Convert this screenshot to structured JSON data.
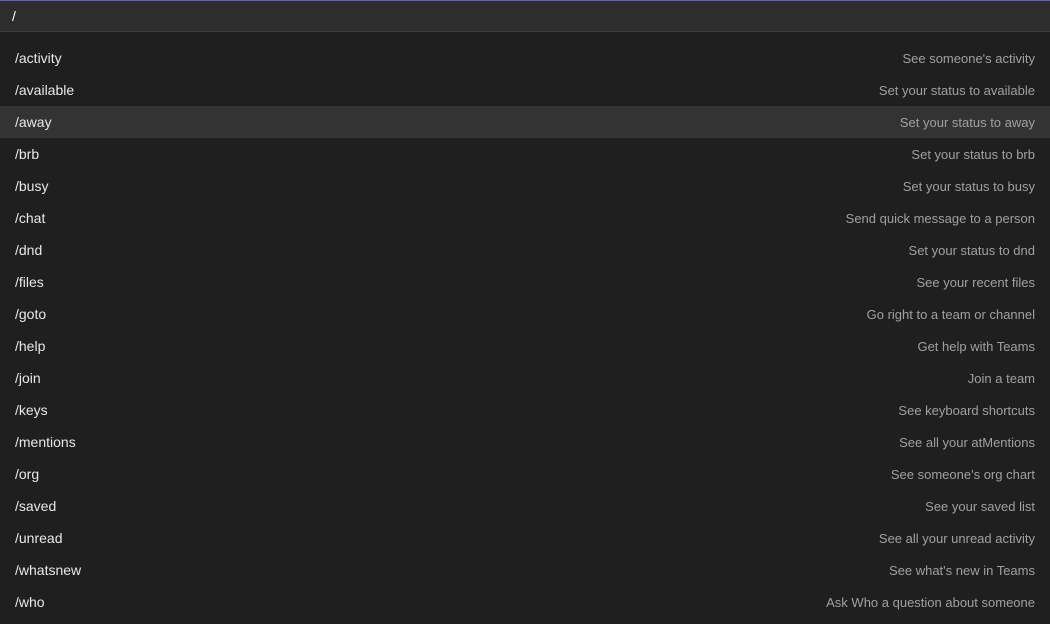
{
  "search": {
    "value": "/"
  },
  "commands": [
    {
      "name": "/activity",
      "desc": "See someone's activity",
      "highlighted": false
    },
    {
      "name": "/available",
      "desc": "Set your status to available",
      "highlighted": false
    },
    {
      "name": "/away",
      "desc": "Set your status to away",
      "highlighted": true
    },
    {
      "name": "/brb",
      "desc": "Set your status to brb",
      "highlighted": false
    },
    {
      "name": "/busy",
      "desc": "Set your status to busy",
      "highlighted": false
    },
    {
      "name": "/chat",
      "desc": "Send quick message to a person",
      "highlighted": false
    },
    {
      "name": "/dnd",
      "desc": "Set your status to dnd",
      "highlighted": false
    },
    {
      "name": "/files",
      "desc": "See your recent files",
      "highlighted": false
    },
    {
      "name": "/goto",
      "desc": "Go right to a team or channel",
      "highlighted": false
    },
    {
      "name": "/help",
      "desc": "Get help with Teams",
      "highlighted": false
    },
    {
      "name": "/join",
      "desc": "Join a team",
      "highlighted": false
    },
    {
      "name": "/keys",
      "desc": "See keyboard shortcuts",
      "highlighted": false
    },
    {
      "name": "/mentions",
      "desc": "See all your atMentions",
      "highlighted": false
    },
    {
      "name": "/org",
      "desc": "See someone's org chart",
      "highlighted": false
    },
    {
      "name": "/saved",
      "desc": "See your saved list",
      "highlighted": false
    },
    {
      "name": "/unread",
      "desc": "See all your unread activity",
      "highlighted": false
    },
    {
      "name": "/whatsnew",
      "desc": "See what's new in Teams",
      "highlighted": false
    },
    {
      "name": "/who",
      "desc": "Ask Who a question about someone",
      "highlighted": false
    }
  ]
}
